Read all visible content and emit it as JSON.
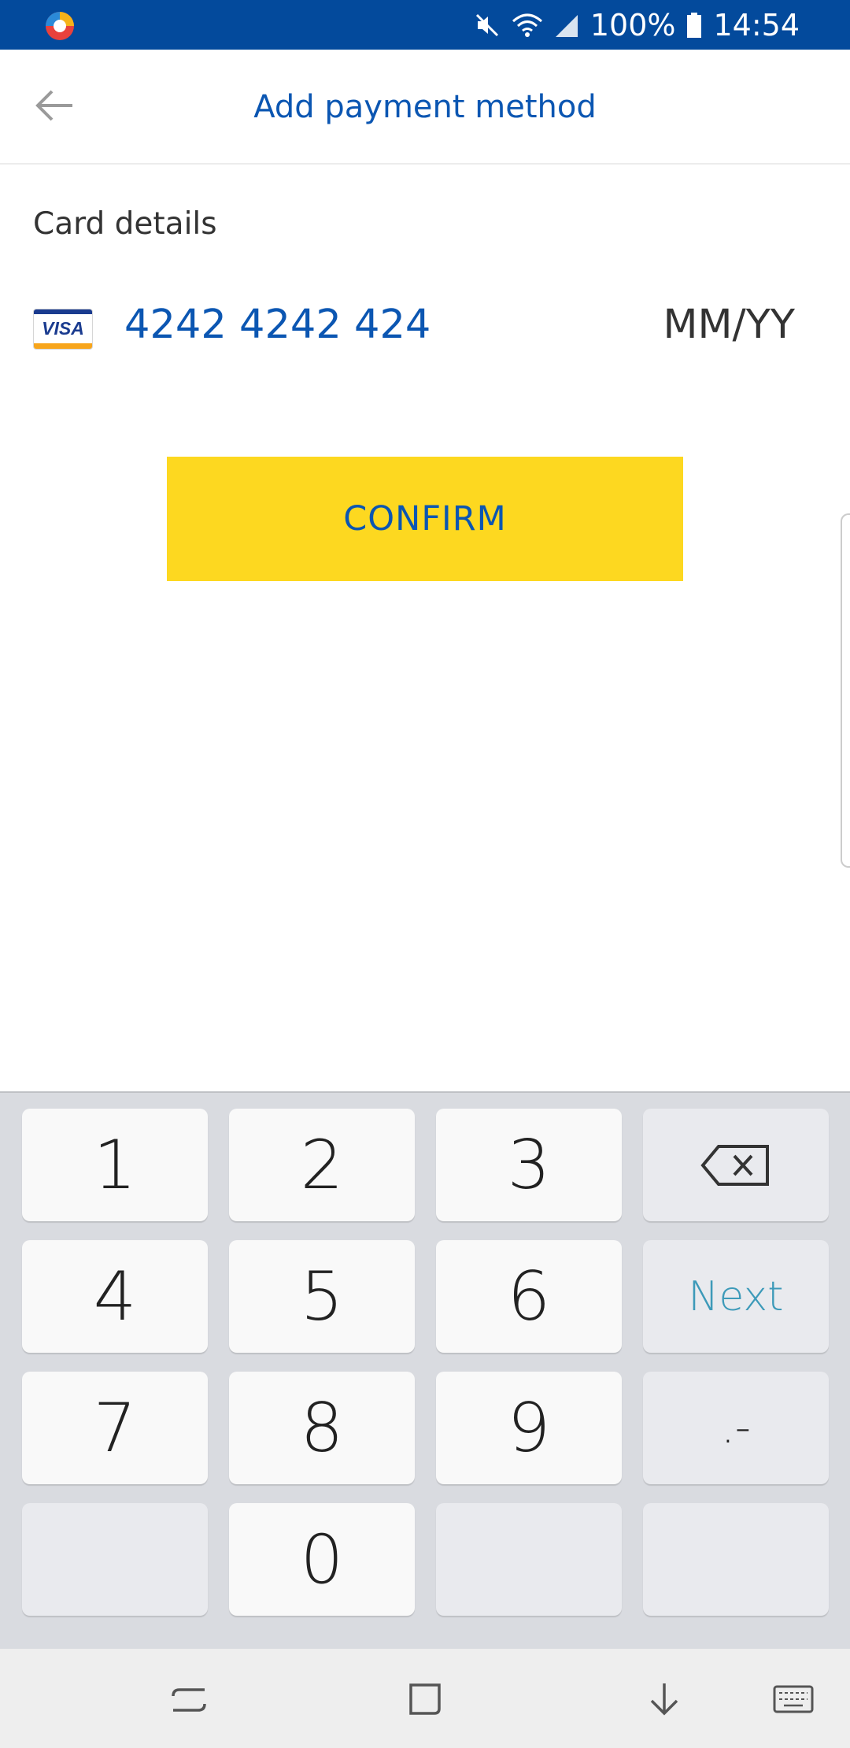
{
  "status_bar": {
    "battery": "100%",
    "time": "14:54",
    "icons": [
      "mute-icon",
      "wifi-icon",
      "signal-icon",
      "battery-icon"
    ]
  },
  "header": {
    "title": "Add payment method",
    "back_icon": "arrow-left-icon"
  },
  "card": {
    "section_label": "Card details",
    "brand": "VISA",
    "number": "4242 4242 424",
    "expiry_placeholder": "MM/YY"
  },
  "confirm_label": "CONFIRM",
  "keyboard": {
    "keys": [
      "1",
      "2",
      "3",
      "4",
      "5",
      "6",
      "7",
      "8",
      "9",
      "0"
    ],
    "next_label": "Next",
    "symbols_label": ".-",
    "backspace_icon": "backspace-icon"
  },
  "navbar": {
    "icons": [
      "recents-icon",
      "home-icon",
      "hide-keyboard-icon",
      "keyboard-switch-icon"
    ]
  },
  "colors": {
    "status_bar": "#034a9c",
    "accent_blue": "#0b56b2",
    "confirm_yellow": "#fdd820",
    "next_key": "#3d9ab9"
  }
}
